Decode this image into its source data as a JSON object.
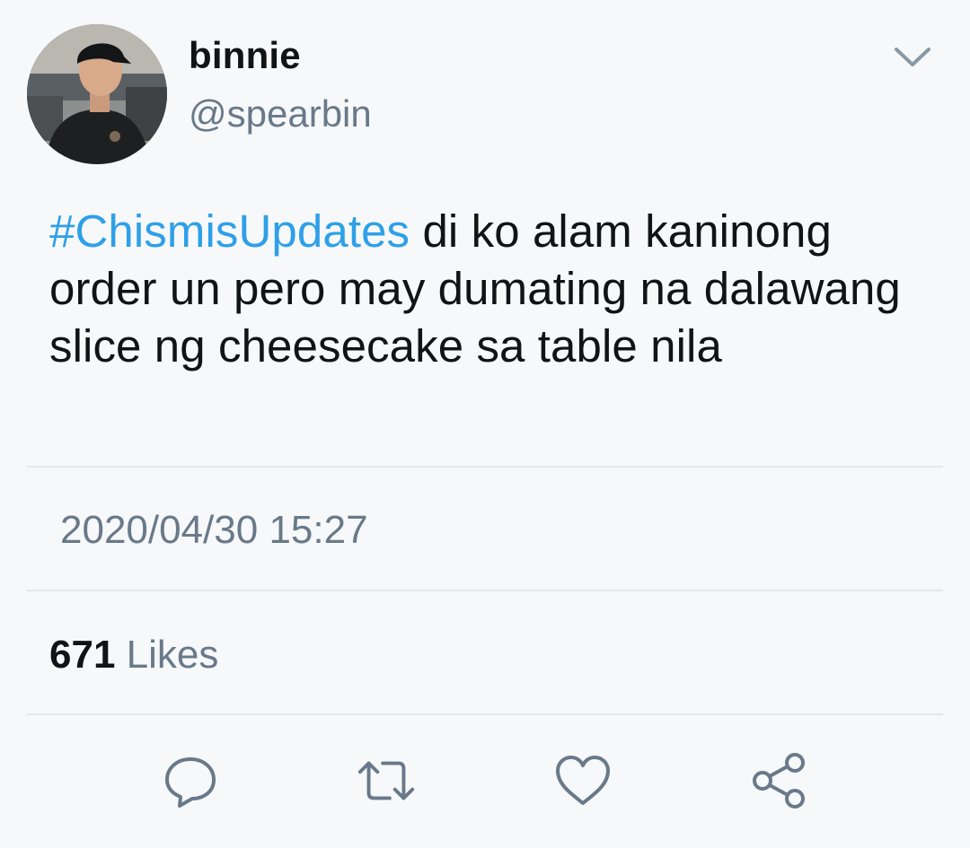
{
  "author": {
    "name": "binnie",
    "handle": "@spearbin"
  },
  "tweet": {
    "hashtag": "#ChismisUpdates",
    "text": " di ko alam kaninong order un pero may dumating na dalawang slice ng cheesecake sa table nila",
    "timestamp": "2020/04/30 15:27"
  },
  "stats": {
    "likes_count": "671",
    "likes_label": "Likes"
  },
  "actions": [
    {
      "name": "reply",
      "icon": "reply-icon"
    },
    {
      "name": "retweet",
      "icon": "retweet-icon"
    },
    {
      "name": "like",
      "icon": "heart-icon"
    },
    {
      "name": "share",
      "icon": "share-icon"
    }
  ],
  "colors": {
    "background": "#f7f8f9",
    "hashtag": "#2ea0e8",
    "secondary_text": "#68798a",
    "icon": "#68798a",
    "divider": "#e4e7ea"
  }
}
